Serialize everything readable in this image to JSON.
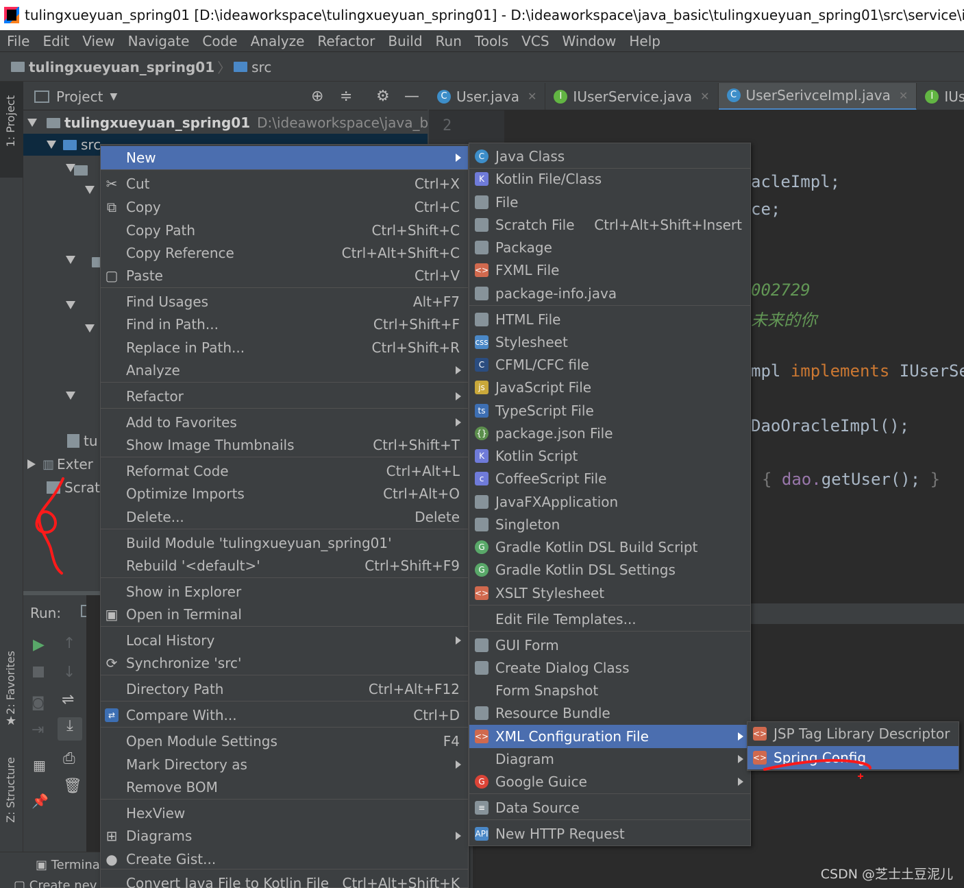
{
  "title_bar": {
    "text": "tulingxueyuan_spring01 [D:\\ideaworkspace\\tulingxueyuan_spring01] - D:\\ideaworkspace\\java_basic\\tulingxueyuan_spring01\\src\\service\\impl\\UserSeri"
  },
  "menu_bar": [
    "File",
    "Edit",
    "View",
    "Navigate",
    "Code",
    "Analyze",
    "Refactor",
    "Build",
    "Run",
    "Tools",
    "VCS",
    "Window",
    "Help"
  ],
  "breadcrumb": {
    "project": "tulingxueyuan_spring01",
    "folder": "src"
  },
  "left_strip": {
    "project_tab": "1: Project",
    "favorites_tab": "2: Favorites",
    "structure_tab": "Z: Structure"
  },
  "project_panel": {
    "header": "Project",
    "root_name": "tulingxueyuan_spring01",
    "root_path": "D:\\ideaworkspace\\java_basic\\tu",
    "src_label": "src",
    "tu_label": "tu",
    "external_label": "Exter",
    "scratches_label": "Scrat"
  },
  "editor_tabs": [
    {
      "label": "User.java",
      "icon": "C"
    },
    {
      "label": "IUserService.java",
      "icon": "I"
    },
    {
      "label": "UserSerivceImpl.java",
      "icon": "C"
    },
    {
      "label": "IUserDa",
      "icon": "I"
    }
  ],
  "editor": {
    "line_number": "2",
    "lines": [
      "acleImpl;",
      "ce;",
      "002729",
      "未来的你",
      "mpl",
      "implements",
      "IUserSe",
      "DaoOracleImpl();",
      "{",
      "dao.",
      "getUser();",
      "}"
    ]
  },
  "run_panel": {
    "label": "Run:",
    "terminal": "Termina",
    "create": "Create nev"
  },
  "context_menu": [
    {
      "label": "New",
      "shortcut": "",
      "submenu": true,
      "selected": true
    },
    {
      "label": "Cut",
      "shortcut": "Ctrl+X",
      "icon": "scissors-icon"
    },
    {
      "label": "Copy",
      "shortcut": "Ctrl+C",
      "icon": "copy-icon"
    },
    {
      "label": "Copy Path",
      "shortcut": "Ctrl+Shift+C"
    },
    {
      "label": "Copy Reference",
      "shortcut": "Ctrl+Alt+Shift+C"
    },
    {
      "label": "Paste",
      "shortcut": "Ctrl+V",
      "icon": "paste-icon"
    },
    {
      "label": "Find Usages",
      "shortcut": "Alt+F7"
    },
    {
      "label": "Find in Path...",
      "shortcut": "Ctrl+Shift+F"
    },
    {
      "label": "Replace in Path...",
      "shortcut": "Ctrl+Shift+R"
    },
    {
      "label": "Analyze",
      "shortcut": "",
      "submenu": true
    },
    {
      "label": "Refactor",
      "shortcut": "",
      "submenu": true
    },
    {
      "label": "Add to Favorites",
      "shortcut": "",
      "submenu": true
    },
    {
      "label": "Show Image Thumbnails",
      "shortcut": "Ctrl+Shift+T"
    },
    {
      "label": "Reformat Code",
      "shortcut": "Ctrl+Alt+L"
    },
    {
      "label": "Optimize Imports",
      "shortcut": "Ctrl+Alt+O"
    },
    {
      "label": "Delete...",
      "shortcut": "Delete"
    },
    {
      "label": "Build Module 'tulingxueyuan_spring01'",
      "shortcut": ""
    },
    {
      "label": "Rebuild '<default>'",
      "shortcut": "Ctrl+Shift+F9"
    },
    {
      "label": "Show in Explorer",
      "shortcut": ""
    },
    {
      "label": "Open in Terminal",
      "shortcut": "",
      "icon": "terminal-icon"
    },
    {
      "label": "Local History",
      "shortcut": "",
      "submenu": true
    },
    {
      "label": "Synchronize 'src'",
      "shortcut": "",
      "icon": "sync-icon"
    },
    {
      "label": "Directory Path",
      "shortcut": "Ctrl+Alt+F12"
    },
    {
      "label": "Compare With...",
      "shortcut": "Ctrl+D",
      "icon": "compare-icon"
    },
    {
      "label": "Open Module Settings",
      "shortcut": "F4"
    },
    {
      "label": "Mark Directory as",
      "shortcut": "",
      "submenu": true
    },
    {
      "label": "Remove BOM",
      "shortcut": ""
    },
    {
      "label": "HexView",
      "shortcut": ""
    },
    {
      "label": "Diagrams",
      "shortcut": "",
      "submenu": true,
      "icon": "diagram-icon"
    },
    {
      "label": "Create Gist...",
      "shortcut": "",
      "icon": "github-icon"
    },
    {
      "label": "Convert Java File to Kotlin File",
      "shortcut": "Ctrl+Alt+Shift+K"
    }
  ],
  "new_submenu": [
    {
      "label": "Java Class",
      "shortcut": "",
      "icon": "java-class-icon"
    },
    {
      "label": "Kotlin File/Class",
      "shortcut": "",
      "icon": "kotlin-file-icon"
    },
    {
      "label": "File",
      "shortcut": "",
      "icon": "file-icon"
    },
    {
      "label": "Scratch File",
      "shortcut": "Ctrl+Alt+Shift+Insert",
      "icon": "scratch-file-icon"
    },
    {
      "label": "Package",
      "shortcut": "",
      "icon": "package-icon"
    },
    {
      "label": "FXML File",
      "shortcut": "",
      "icon": "fxml-file-icon"
    },
    {
      "label": "package-info.java",
      "shortcut": "",
      "icon": "package-info-icon"
    },
    {
      "label": "HTML File",
      "shortcut": "",
      "icon": "html-file-icon"
    },
    {
      "label": "Stylesheet",
      "shortcut": "",
      "icon": "stylesheet-icon"
    },
    {
      "label": "CFML/CFC file",
      "shortcut": "",
      "icon": "cfml-icon"
    },
    {
      "label": "JavaScript File",
      "shortcut": "",
      "icon": "javascript-file-icon"
    },
    {
      "label": "TypeScript File",
      "shortcut": "",
      "icon": "typescript-file-icon"
    },
    {
      "label": "package.json File",
      "shortcut": "",
      "icon": "package-json-icon"
    },
    {
      "label": "Kotlin Script",
      "shortcut": "",
      "icon": "kotlin-script-icon"
    },
    {
      "label": "CoffeeScript File",
      "shortcut": "",
      "icon": "coffeescript-icon"
    },
    {
      "label": "JavaFXApplication",
      "shortcut": "",
      "icon": "javafx-icon"
    },
    {
      "label": "Singleton",
      "shortcut": "",
      "icon": "singleton-icon"
    },
    {
      "label": "Gradle Kotlin DSL Build Script",
      "shortcut": "",
      "icon": "gradle-icon"
    },
    {
      "label": "Gradle Kotlin DSL Settings",
      "shortcut": "",
      "icon": "gradle-icon"
    },
    {
      "label": "XSLT Stylesheet",
      "shortcut": "",
      "icon": "xslt-icon"
    },
    {
      "label": "Edit File Templates...",
      "shortcut": ""
    },
    {
      "label": "GUI Form",
      "shortcut": "",
      "icon": "gui-form-icon"
    },
    {
      "label": "Create Dialog Class",
      "shortcut": "",
      "icon": "dialog-class-icon"
    },
    {
      "label": "Form Snapshot",
      "shortcut": ""
    },
    {
      "label": "Resource Bundle",
      "shortcut": "",
      "icon": "resource-bundle-icon"
    },
    {
      "label": "XML Configuration File",
      "shortcut": "",
      "submenu": true,
      "selected": true,
      "icon": "xml-config-icon"
    },
    {
      "label": "Diagram",
      "shortcut": "",
      "submenu": true
    },
    {
      "label": "Google Guice",
      "shortcut": "",
      "submenu": true,
      "icon": "google-icon"
    },
    {
      "label": "Data Source",
      "shortcut": "",
      "icon": "database-icon"
    },
    {
      "label": "New HTTP Request",
      "shortcut": "",
      "icon": "http-request-icon"
    }
  ],
  "xml_submenu": [
    {
      "label": "JSP Tag Library Descriptor",
      "icon": "jsp-tld-icon"
    },
    {
      "label": "Spring Config",
      "icon": "spring-config-icon",
      "selected": true
    }
  ],
  "watermark": "CSDN @芝士土豆泥儿",
  "colors": {
    "selection": "#4b6eaf",
    "menu_bg": "#3c3f41",
    "editor_bg": "#2b2b2b",
    "annotation": "#ff1a1a"
  }
}
